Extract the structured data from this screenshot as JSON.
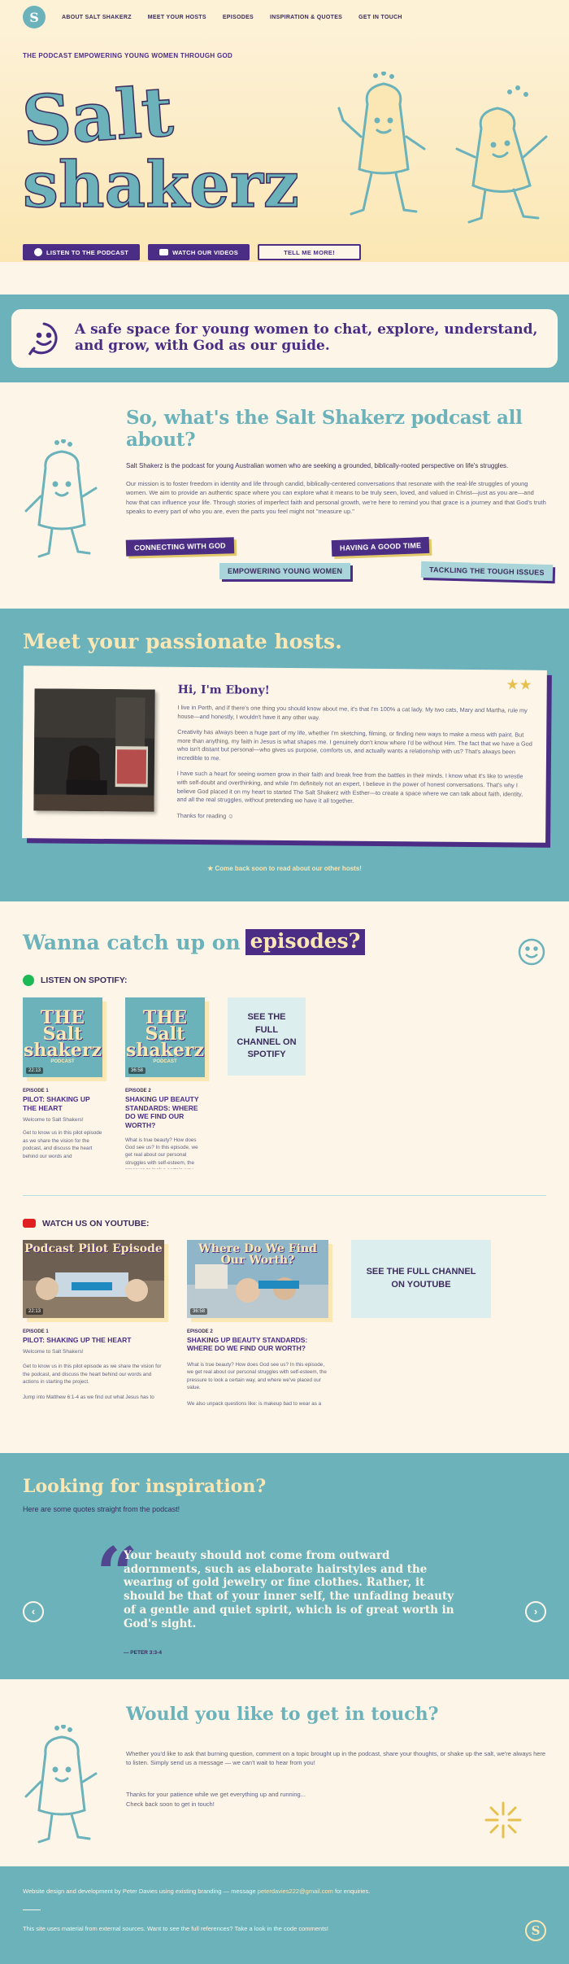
{
  "nav": {
    "logo_text": "S",
    "items": [
      "ABOUT SALT SHAKERZ",
      "MEET YOUR HOSTS",
      "EPISODES",
      "INSPIRATION & QUOTES",
      "GET IN TOUCH"
    ]
  },
  "hero": {
    "tagline": "THE PODCAST EMPOWERING YOUNG WOMEN THROUGH GOD",
    "wordmark_line1": "Salt",
    "wordmark_line2": "shakerz",
    "buttons": {
      "listen": "LISTEN TO THE PODCAST",
      "watch": "WATCH OUR VIDEOS",
      "tell": "TELL ME MORE!"
    }
  },
  "strip": {
    "text": "A safe space for young women to chat, explore, understand, and grow, with God as our guide."
  },
  "about": {
    "title": "So, what's the Salt Shakerz podcast all about?",
    "lead": "Salt Shakerz is the podcast for young Australian women who are seeking a grounded, biblically-rooted perspective on life's struggles.",
    "body": "Our mission is to foster freedom in identity and life through candid, biblically-centered conversations that resonate with the real-life struggles of young women. We aim to provide an authentic space where you can explore what it means to be truly seen, loved, and valued in Christ—just as you are—and how that can influence your life. Through stories of imperfect faith and personal growth, we're here to remind you that grace is a journey and that God's truth speaks to every part of who you are, even the parts you feel might not \"measure up.\"",
    "pills": {
      "connecting": "CONNECTING WITH GOD",
      "good_time": "HAVING A GOOD TIME",
      "empowering": "EMPOWERING YOUNG WOMEN",
      "tackling": "TACKLING THE TOUGH ISSUES"
    }
  },
  "hosts": {
    "title": "Meet your passionate hosts.",
    "card": {
      "greeting": "Hi, I'm Ebony!",
      "p1": "I live in Perth, and if there's one thing you should know about me, it's that I'm 100% a cat lady. My two cats, Mary and Martha, rule my house—and honestly, I wouldn't have it any other way.",
      "p2": "Creativity has always been a huge part of my life, whether I'm sketching, filming, or finding new ways to make a mess with paint. But more than anything, my faith in Jesus is what shapes me. I genuinely don't know where I'd be without Him. The fact that we have a God who isn't distant but personal—who gives us purpose, comforts us, and actually wants a relationship with us? That's always been incredible to me.",
      "p3": "I have such a heart for seeing women grow in their faith and break free from the battles in their minds. I know what it's like to wrestle with self-doubt and overthinking, and while I'm definitely not an expert, I believe in the power of honest conversations. That's why I believe God placed it on my heart to started The Salt Shakerz with Esther—to create a space where we can talk about faith, identity, and all the real struggles, without pretending we have it all together.",
      "p4": "Thanks for reading ☺"
    },
    "soon": "Come back soon to read about our other hosts!"
  },
  "episodes": {
    "title_prefix": "Wanna catch up on",
    "title_highlight": "episodes?",
    "spotify": {
      "label": "LISTEN ON SPOTIFY:",
      "items": [
        {
          "art_title": "THE Salt shakerz",
          "art_sub": "PODCAST",
          "duration": "22:13",
          "number": "EPISODE 1",
          "title": "PILOT: SHAKING UP THE HEART",
          "welcome": "Welcome to Salt Shakers!",
          "desc": "Get to know us in this pilot episode as we share the vision for the podcast, and discuss the heart behind our words and"
        },
        {
          "art_title": "THE Salt shakerz",
          "art_sub": "PODCAST",
          "duration": "36:58",
          "number": "EPISODE 2",
          "title": "SHAKING UP BEAUTY STANDARDS: WHERE DO WE FIND OUR WORTH?",
          "welcome": "",
          "desc": "What is true beauty? How does God see us? In this episode, we get real about our personal struggles with self-esteem, the pressure to look a certain way"
        }
      ],
      "see_full": "SEE THE FULL CHANNEL ON SPOTIFY"
    },
    "youtube": {
      "label": "WATCH US ON YOUTUBE:",
      "items": [
        {
          "art_title": "Podcast Pilot Episode",
          "duration": "22:13",
          "number": "EPISODE 1",
          "title": "PILOT: SHAKING UP THE HEART",
          "welcome": "Welcome to Salt Shakers!",
          "desc": "Get to know us in this pilot episode as we share the vision for the podcast, and discuss the heart behind our words and actions in starting the project.",
          "desc2": "Jump into Matthew 6:1-4 as we find out what Jesus has to"
        },
        {
          "art_title": "Where Do We Find Our Worth?",
          "duration": "36:58",
          "number": "EPISODE 2",
          "title": "SHAKING UP BEAUTY STANDARDS: WHERE DO WE FIND OUR WORTH?",
          "welcome": "",
          "desc": "What is true beauty? How does God see us? In this episode, we get real about our personal struggles with self-esteem, the pressure to look a certain way, and where we've placed our value.",
          "desc2": "We also unpack questions like: is makeup bad to wear as a"
        }
      ],
      "see_full": "SEE THE FULL CHANNEL ON YOUTUBE"
    }
  },
  "quotes": {
    "title": "Looking for inspiration?",
    "subtitle": "Here are some quotes straight from the podcast!",
    "quote": "Your beauty should not come from outward adornments, such as elaborate hairstyles and the wearing of gold jewelry or fine clothes. Rather, it should be that of your inner self, the unfading beauty of a gentle and quiet spirit, which is of great worth in God's sight.",
    "reference": "— PETER 3:3-4",
    "prev": "‹",
    "next": "›"
  },
  "contact": {
    "title": "Would you like to get in touch?",
    "p1": "Whether you'd like to ask that burning question, comment on a topic brought up in the podcast, share your thoughts, or shake up the salt, we're always here to listen. Simply send us a message — we can't wait to hear from you!",
    "p2a": "Thanks for your patience while we get everything up and running...",
    "p2b": "Check back soon to get in touch!"
  },
  "footer": {
    "credit_pre": "Website design and development by Peter Davies using existing branding — message ",
    "email": "peterdavies222@gmail.com",
    "credit_post": " for enquiries.",
    "note": "This site uses material from external sources. Want to see the full references? Take a look in the code comments!",
    "logo_text": "S"
  },
  "colors": {
    "teal": "#6bb2bb",
    "purple": "#4b2d86",
    "cream": "#fdf6e8",
    "butter": "#fbe7b4",
    "gold": "#e6c04d"
  }
}
